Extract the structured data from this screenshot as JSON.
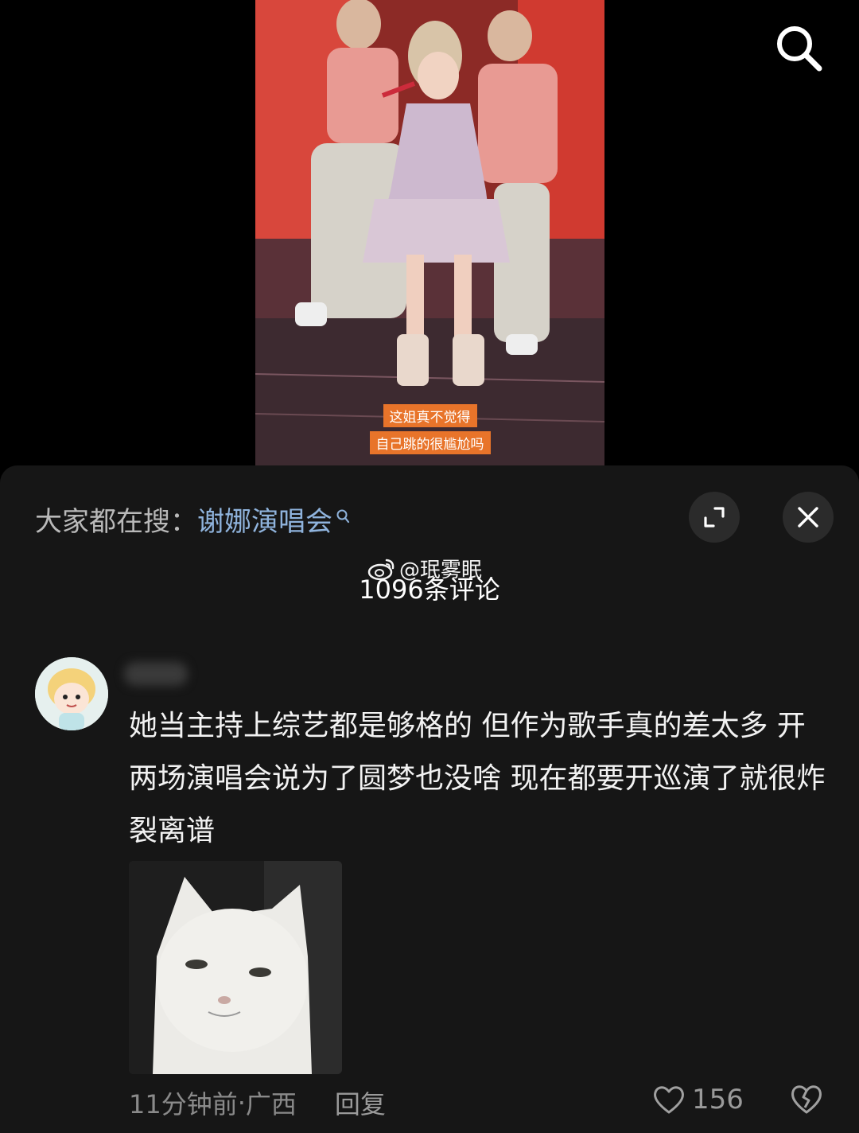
{
  "video": {
    "subtitle_line1": "这姐真不觉得",
    "subtitle_line2": "自己跳的很尴尬吗",
    "search_icon": "search-icon"
  },
  "sheet": {
    "trending_prefix": "大家都在搜：",
    "trending_keyword": "谢娜演唱会",
    "expand_icon": "expand-icon",
    "close_icon": "close-icon",
    "comment_count": "1096条评论",
    "watermark": "@珉雾眠"
  },
  "comment": {
    "text": "她当主持上综艺都是够格的  但作为歌手真的差太多  开两场演唱会说为了圆梦也没啥  现在都要开巡演了就很炸裂离谱",
    "time": "11分钟前",
    "location": "广西",
    "separator": " · ",
    "reply_label": "回复",
    "like_count": "156"
  },
  "colors": {
    "sheet_bg": "#161616",
    "keyword": "#8fb3dc",
    "subtitle_bg": "#e8742a"
  }
}
